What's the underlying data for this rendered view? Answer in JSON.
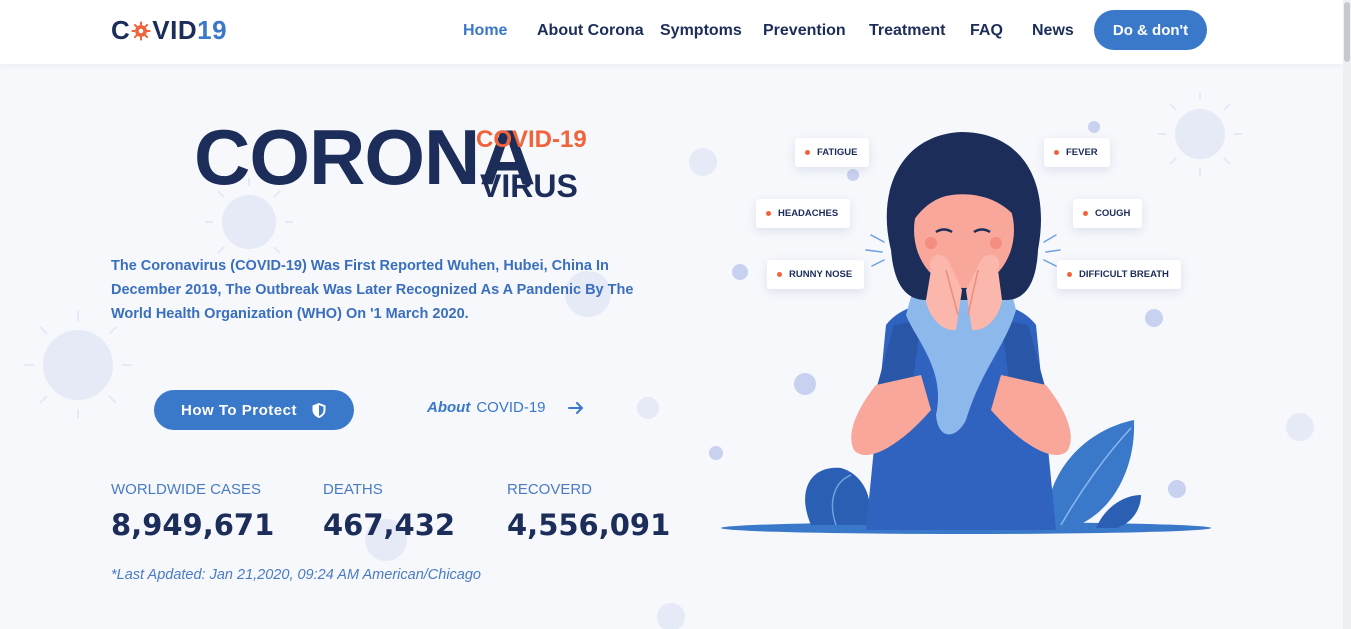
{
  "brand": {
    "logo_prefix": "C",
    "logo_mid": "VID",
    "logo_num": "19",
    "logo_icon": "virus-gear-icon"
  },
  "nav": {
    "items": [
      {
        "label": "Home",
        "active": true
      },
      {
        "label": "About Corona"
      },
      {
        "label": "Symptoms"
      },
      {
        "label": "Prevention"
      },
      {
        "label": "Treatment"
      },
      {
        "label": "FAQ"
      },
      {
        "label": "News"
      }
    ],
    "cta_label": "Do & don't"
  },
  "hero": {
    "title_main": "CORONA",
    "title_covid": "COVID-19",
    "title_virus": "VIRUS",
    "description": "The Coronavirus (COVID-19) Was First Reported Wuhen, Hubei, China In December 2019, The Outbreak Was Later Recognized As A Pandenic By The World Health Organization (WHO) On '1 March 2020.",
    "protect_button": "How To Protect",
    "protect_icon": "shield-icon",
    "about_link_em": "About",
    "about_link_rest": "COVID-19",
    "about_link_icon": "arrow-right-icon"
  },
  "stats": {
    "worldwide_label": "WORLDWIDE CASES",
    "worldwide_value": "8,949,671",
    "deaths_label": "DEATHS",
    "deaths_value": "467,432",
    "recovered_label": "RECOVERD",
    "recovered_value": "4,556,091",
    "last_updated": "*Last Apdated: Jan 21,2020, 09:24 AM American/Chicago"
  },
  "symptoms": {
    "fatigue": "FATIGUE",
    "fever": "FEVER",
    "headaches": "HEADACHES",
    "cough": "COUGH",
    "runny_nose": "RUNNY NOSE",
    "difficult_breath": "DIFFICULT BREATH"
  },
  "colors": {
    "primary": "#3a78c9",
    "navy": "#1c2d5a",
    "accent": "#f0643c",
    "background": "#f6f8fc"
  }
}
